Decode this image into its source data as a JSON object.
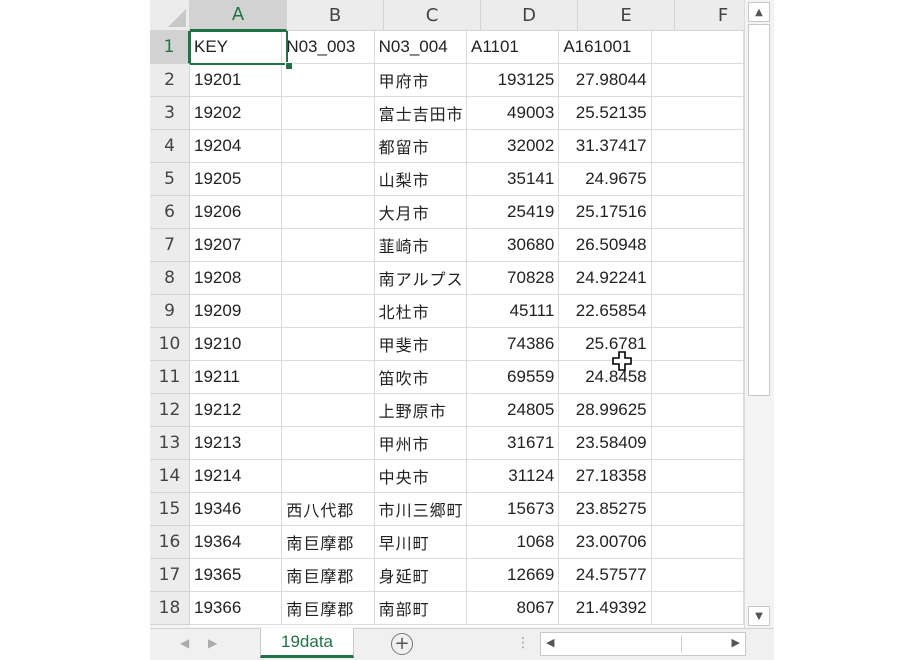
{
  "columns": [
    "A",
    "B",
    "C",
    "D",
    "E",
    "F"
  ],
  "rows": [
    {
      "n": "1",
      "cells": [
        "KEY",
        "N03_003",
        "N03_004",
        "A1101",
        "A161001",
        ""
      ]
    },
    {
      "n": "2",
      "cells": [
        "19201",
        "",
        "甲府市",
        "193125",
        "27.98044",
        ""
      ]
    },
    {
      "n": "3",
      "cells": [
        "19202",
        "",
        "富士吉田市",
        "49003",
        "25.52135",
        ""
      ]
    },
    {
      "n": "4",
      "cells": [
        "19204",
        "",
        "都留市",
        "32002",
        "31.37417",
        ""
      ]
    },
    {
      "n": "5",
      "cells": [
        "19205",
        "",
        "山梨市",
        "35141",
        "24.9675",
        ""
      ]
    },
    {
      "n": "6",
      "cells": [
        "19206",
        "",
        "大月市",
        "25419",
        "25.17516",
        ""
      ]
    },
    {
      "n": "7",
      "cells": [
        "19207",
        "",
        "韮崎市",
        "30680",
        "26.50948",
        ""
      ]
    },
    {
      "n": "8",
      "cells": [
        "19208",
        "",
        "南アルプス",
        "70828",
        "24.92241",
        ""
      ]
    },
    {
      "n": "9",
      "cells": [
        "19209",
        "",
        "北杜市",
        "45111",
        "22.65854",
        ""
      ]
    },
    {
      "n": "10",
      "cells": [
        "19210",
        "",
        "甲斐市",
        "74386",
        "25.6781",
        ""
      ]
    },
    {
      "n": "11",
      "cells": [
        "19211",
        "",
        "笛吹市",
        "69559",
        "24.8458",
        ""
      ]
    },
    {
      "n": "12",
      "cells": [
        "19212",
        "",
        "上野原市",
        "24805",
        "28.99625",
        ""
      ]
    },
    {
      "n": "13",
      "cells": [
        "19213",
        "",
        "甲州市",
        "31671",
        "23.58409",
        ""
      ]
    },
    {
      "n": "14",
      "cells": [
        "19214",
        "",
        "中央市",
        "31124",
        "27.18358",
        ""
      ]
    },
    {
      "n": "15",
      "cells": [
        "19346",
        "西八代郡",
        "市川三郷町",
        "15673",
        "23.85275",
        ""
      ]
    },
    {
      "n": "16",
      "cells": [
        "19364",
        "南巨摩郡",
        "早川町",
        "1068",
        "23.00706",
        ""
      ]
    },
    {
      "n": "17",
      "cells": [
        "19365",
        "南巨摩郡",
        "身延町",
        "12669",
        "24.57577",
        ""
      ]
    },
    {
      "n": "18",
      "cells": [
        "19366",
        "南巨摩郡",
        "南部町",
        "8067",
        "21.49392",
        ""
      ]
    }
  ],
  "sheet_tab": "19data",
  "active_cell": "A1",
  "accent_color": "#217346"
}
